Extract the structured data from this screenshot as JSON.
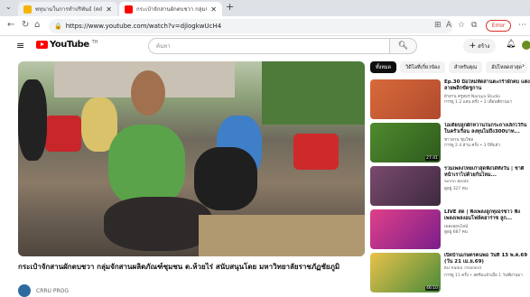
{
  "browser": {
    "tabs": [
      {
        "label": "พหุนามในการทำปริพันธ์ (คณิต...",
        "active": false
      },
      {
        "label": "กระเป๋าจักสานผักตบชวา กลุ่มจักสาน...",
        "active": true
      }
    ],
    "new_tab": "+",
    "url": "https://www.youtube.com/watch?v=djlogkwUcH4",
    "error_chip": "Error"
  },
  "youtube": {
    "logo": "YouTube",
    "logo_cc": "TH",
    "search_placeholder": "ค้นหา",
    "create_label": "สร้าง"
  },
  "video": {
    "title": "กระเป๋าจักสานผักตบชวา กลุ่มจักสานผลิตภัณฑ์ชุมชน ต.ห้วยไร่ สนับสนุนโดย มหาวิทยาลัยราชภัฏชัยภูมิ",
    "channel": "CRRU PROG"
  },
  "chips": [
    {
      "label": "ทั้งหมด",
      "active": true
    },
    {
      "label": "วิดีโอที่เกี่ยวข้อง",
      "active": false
    },
    {
      "label": "สำหรับคุณ",
      "active": false
    },
    {
      "label": "อัปโหลดล่าสุด",
      "active": false
    }
  ],
  "recommended": [
    {
      "title": "Ep.30 มือใหม่หัดสานตะกร้าผักตบ แต่งลายพลิกขัดชูกาน",
      "channel": "ผ้าสาน ครูสมร Naraya Studio",
      "meta": "การดู 1.2 แสน ครั้ง • 2 เดือนที่ผ่านมา",
      "duration": "",
      "colors": [
        "#d86a3a",
        "#b04a2e"
      ]
    },
    {
      "title": "ไอเดียปลูกผักหวานในกระถางเล็กไว้กินในครัวเรือน ลงทุนไม่ถึง300บาท...",
      "channel": "ชาวสวน ชุมโซล",
      "meta": "การดู 2.4 ล้าน ครั้ง • 3 ปีที่แล้ว",
      "duration": "27:41",
      "colors": [
        "#4f8a2e",
        "#2e5a1c"
      ]
    },
    {
      "title": "รวมเพลงไทยเก่าสุดฟังได้ทั้งวัน | ชาติหน้าเราไปด้วยกันไหม...",
      "channel": "Sirinn Beats",
      "meta": "ดูอยู่ 327 คน",
      "duration": "",
      "colors": [
        "#7a4a6e",
        "#3e2a40"
      ]
    },
    {
      "title": "LIVE สด | ฟังเพลงลูกทุ่งอรชาว ฟังเพลงเพลงอมโฟล์คฮาร่าซ ลูก...",
      "channel": "เพลงออนไลน์",
      "meta": "ดูอยู่ 687 คน",
      "duration": "",
      "colors": [
        "#e0408a",
        "#7a1e8a"
      ]
    },
    {
      "title": "เปิดบ้านเกษตรคนพอ วันที่ 13 พ.ค.69 (วัน 21 เม.ย.69)",
      "channel": "KU Radio Thailand",
      "meta": "การดู 11 ครั้ง • สตรีมแล้วเมื่อ 1 วันที่ผ่านมา",
      "duration": "46:10",
      "colors": [
        "#e8c24a",
        "#4a8a3a"
      ]
    }
  ]
}
